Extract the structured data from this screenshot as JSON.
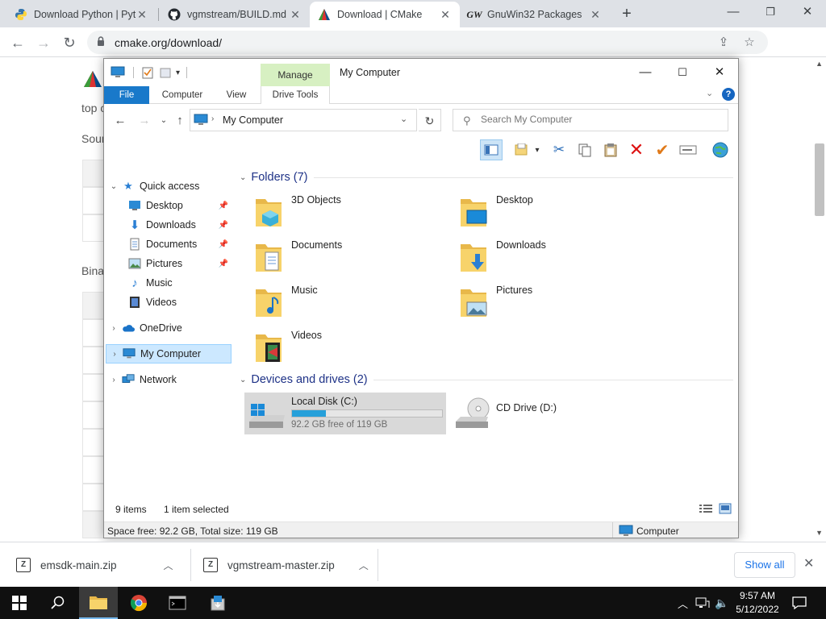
{
  "browser": {
    "tabs": [
      {
        "title": "Download Python | Pyt",
        "active": false
      },
      {
        "title": "vgmstream/BUILD.md",
        "active": false
      },
      {
        "title": "Download | CMake",
        "active": true
      },
      {
        "title": "GnuWin32 Packages",
        "active": false
      }
    ],
    "url": "cmake.org/download/",
    "new_tab_label": "+",
    "page_fragments": {
      "top": "top c",
      "source": "Sour",
      "binary": "Bina"
    }
  },
  "downloads": {
    "items": [
      {
        "name": "emsdk-main.zip"
      },
      {
        "name": "vgmstream-master.zip"
      }
    ],
    "show_all_label": "Show all"
  },
  "taskbar": {
    "time": "9:57 AM",
    "date": "5/12/2022"
  },
  "explorer": {
    "title": "My Computer",
    "manage_label": "Manage",
    "ribbon_tabs": {
      "file": "File",
      "computer": "Computer",
      "view": "View",
      "drive_tools": "Drive Tools"
    },
    "address": "My Computer",
    "search_placeholder": "Search My Computer",
    "nav": {
      "quick_access": "Quick access",
      "quick_items": [
        {
          "label": "Desktop",
          "pinned": true
        },
        {
          "label": "Downloads",
          "pinned": true
        },
        {
          "label": "Documents",
          "pinned": true
        },
        {
          "label": "Pictures",
          "pinned": true
        },
        {
          "label": "Music",
          "pinned": false
        },
        {
          "label": "Videos",
          "pinned": false
        }
      ],
      "onedrive": "OneDrive",
      "my_computer": "My Computer",
      "network": "Network"
    },
    "folders_header": "Folders (7)",
    "folders": [
      {
        "name": "3D Objects",
        "icon": "3d-objects-icon"
      },
      {
        "name": "Desktop",
        "icon": "desktop-icon"
      },
      {
        "name": "Documents",
        "icon": "documents-icon"
      },
      {
        "name": "Downloads",
        "icon": "downloads-icon"
      },
      {
        "name": "Music",
        "icon": "music-icon"
      },
      {
        "name": "Pictures",
        "icon": "pictures-icon"
      },
      {
        "name": "Videos",
        "icon": "videos-icon"
      }
    ],
    "devices_header": "Devices and drives (2)",
    "drives": [
      {
        "name": "Local Disk (C:)",
        "free": "92.2 GB free of 119 GB",
        "used_fraction": 0.225
      },
      {
        "name": "CD Drive (D:)"
      }
    ],
    "status": {
      "items": "9 items",
      "selected": "1 item selected",
      "space": "Space free: 92.2 GB, Total size: 119 GB",
      "location": "Computer"
    },
    "colors": {
      "accent": "#1979ca",
      "manage_bg": "#d7f0c2",
      "progress": "#26a0da",
      "group_text": "#1e3287"
    }
  }
}
